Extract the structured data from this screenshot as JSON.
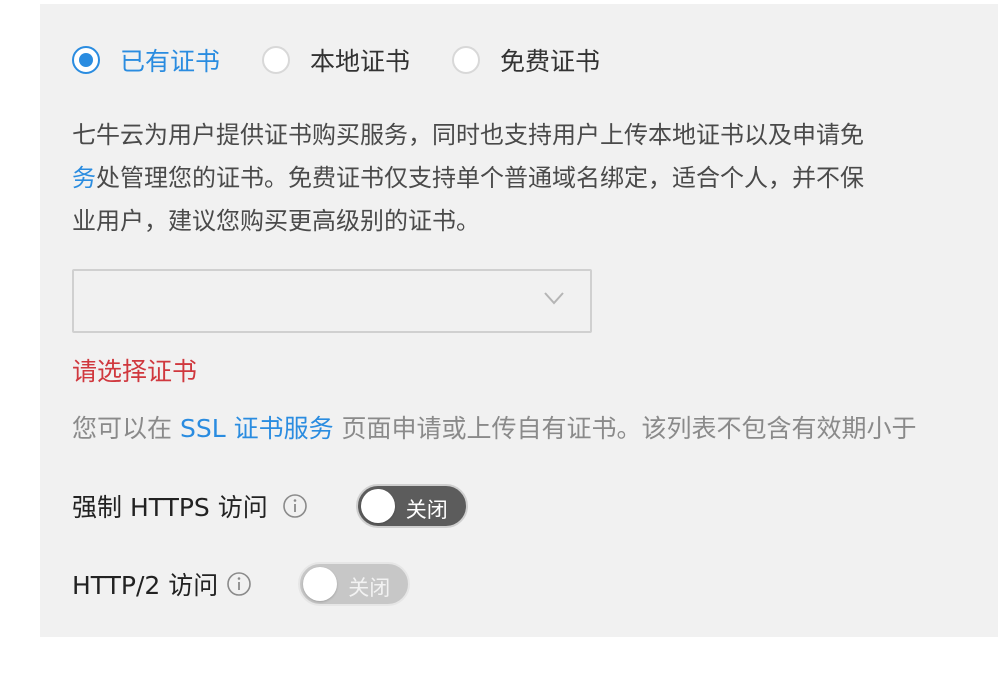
{
  "certificate_type": {
    "options": [
      {
        "label": "已有证书",
        "checked": true
      },
      {
        "label": "本地证书",
        "checked": false
      },
      {
        "label": "免费证书",
        "checked": false
      }
    ]
  },
  "description": {
    "line1": "七牛云为用户提供证书购买服务，同时也支持用户上传本地证书以及申请免",
    "line2_link": "务",
    "line2_rest": "处管理您的证书。免费证书仅支持单个普通域名绑定，适合个人，并不保",
    "line3": "业用户，建议您购买更高级别的证书。"
  },
  "certificate_select": {
    "value": "",
    "icon": "chevron-down-icon"
  },
  "error_message": "请选择证书",
  "hint": {
    "prefix": "您可以在 ",
    "link": "SSL 证书服务",
    "suffix": " 页面申请或上传自有证书。该列表不包含有效期小于"
  },
  "force_https": {
    "label": "强制 HTTPS 访问",
    "toggle_text": "关闭",
    "icon": "info-icon"
  },
  "http2": {
    "label": "HTTP/2 访问",
    "toggle_text": "关闭",
    "icon": "info-icon"
  },
  "colors": {
    "accent": "#2a8ce0",
    "error": "#d0383e",
    "panel_bg": "#f1f1f1"
  }
}
